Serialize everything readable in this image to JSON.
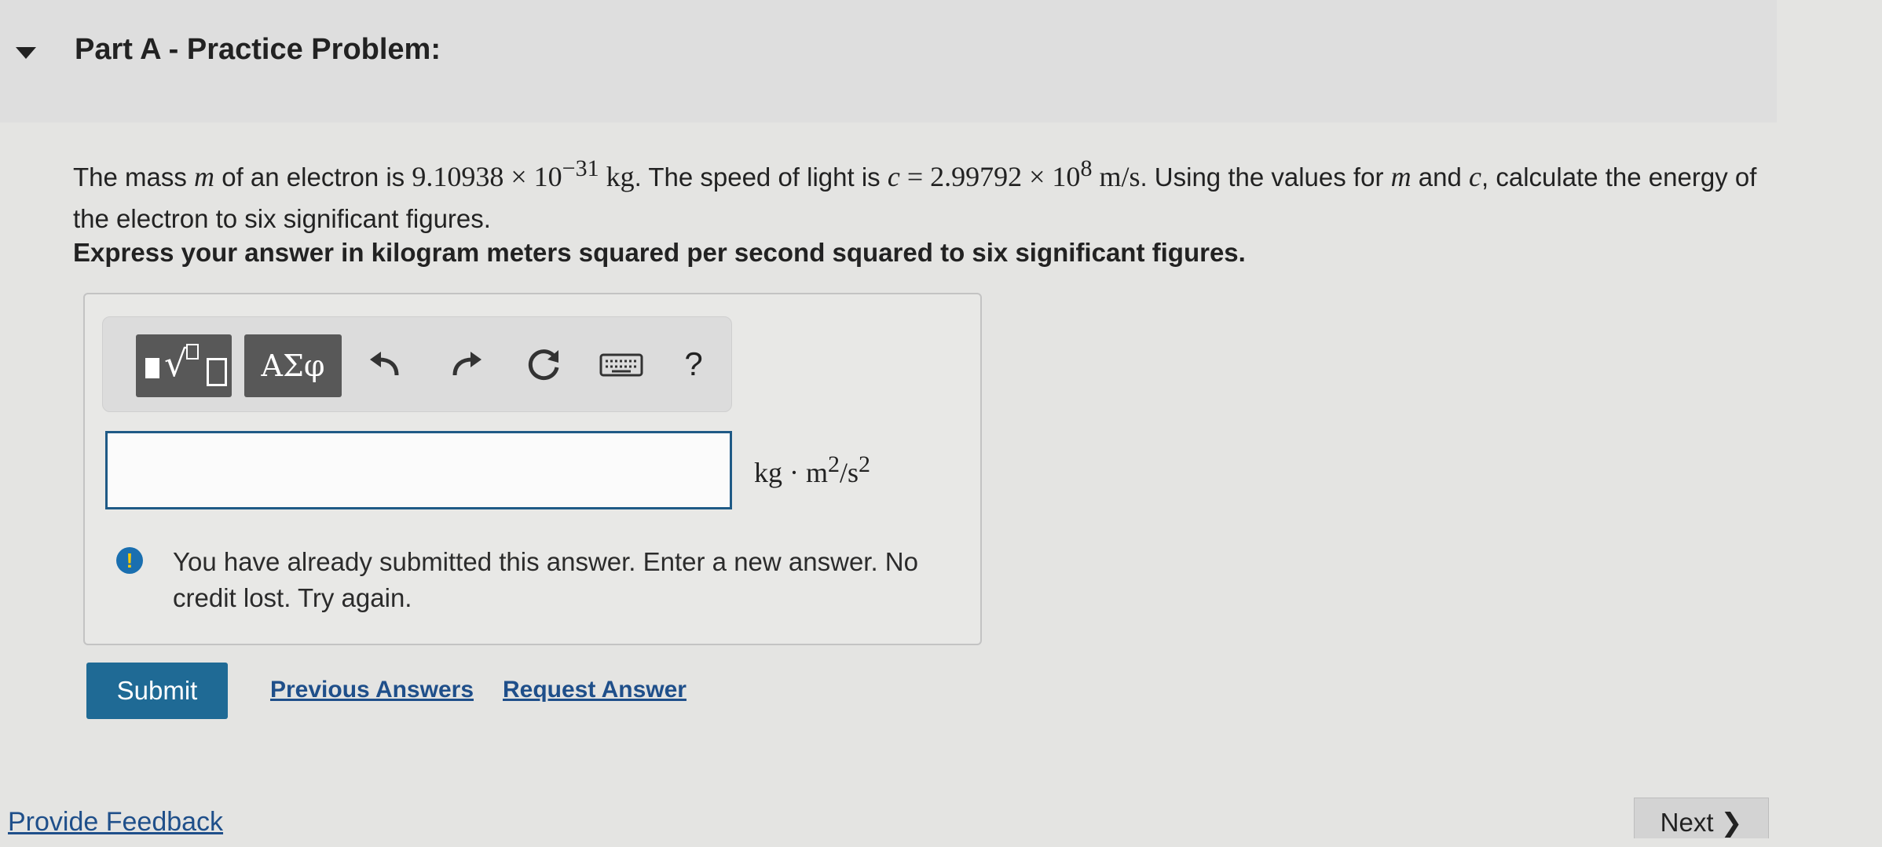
{
  "part": {
    "title": "Part A - Practice Problem:"
  },
  "problem": {
    "t1": "The mass ",
    "m": "m",
    "t2": " of an electron is ",
    "mass_mantissa": "9.10938 × 10",
    "mass_exp": "−31",
    "mass_unit": " kg",
    "t3": ". The speed of light is ",
    "c": "c",
    "c_eq": " = 2.99792 × 10",
    "c_exp": "8",
    "c_unit": " m/s",
    "t4": ". Using the values for ",
    "m2": "m",
    "t5": " and ",
    "c2": "c",
    "t6": ", calculate the energy of the electron to six significant figures.",
    "instruction": "Express your answer in kilogram meters squared per second squared to six significant figures."
  },
  "toolbar": {
    "greek_label": "ΑΣφ",
    "undo_icon": "undo-icon",
    "redo_icon": "redo-icon",
    "reset_icon": "reset-icon",
    "keyboard_icon": "keyboard-icon",
    "help_label": "?"
  },
  "answer": {
    "value": "",
    "units_base": "kg · m",
    "units_exp1": "2",
    "units_mid": "/s",
    "units_exp2": "2"
  },
  "warning": {
    "icon": "!",
    "text": "You have already submitted this answer. Enter a new answer. No credit lost. Try again."
  },
  "actions": {
    "submit_label": "Submit",
    "previous_answers_label": "Previous Answers",
    "request_answer_label": "Request Answer"
  },
  "footer": {
    "feedback_label": "Provide Feedback",
    "next_label": "Next ❯"
  },
  "colors": {
    "accent": "#1f6a95",
    "input_border": "#1f5a86",
    "link": "#1f4f8a",
    "warning_icon_bg": "#1a6fb0"
  }
}
